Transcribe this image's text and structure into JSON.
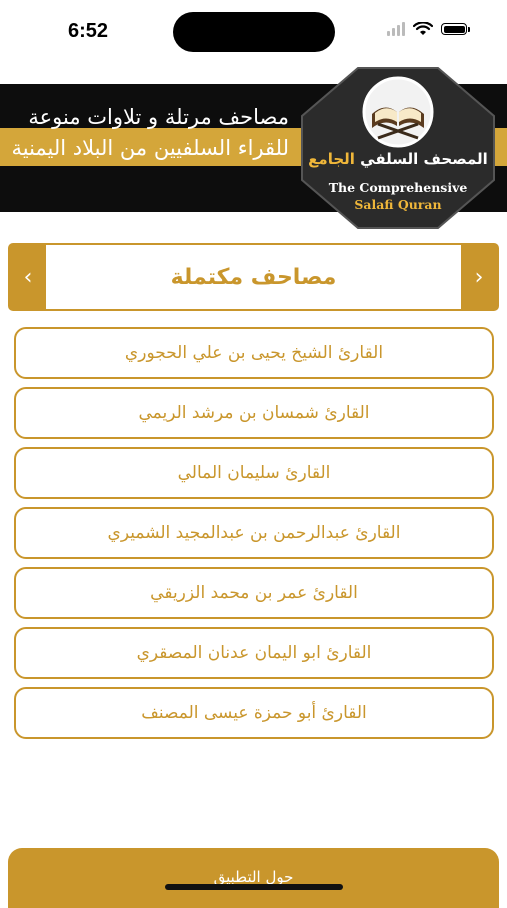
{
  "status": {
    "time": "6:52"
  },
  "banner": {
    "subtitle": "مصاحف مرتلة و تلاوات منوعة للقراء السلفيين من البلاد اليمنية",
    "logo_title_main": "المصحف السلفي",
    "logo_title_accent": "الجامع",
    "logo_en_line1": "The Comprehensive",
    "logo_en_line2": "Salafi Quran"
  },
  "section": {
    "title": "مصاحف مكتملة"
  },
  "reciters": [
    "القارئ الشيخ يحيى بن علي الحجوري",
    "القارئ شمسان بن مرشد الريمي",
    "القارئ سليمان المالي",
    "القارئ عبدالرحمن بن عبدالمجيد الشميري",
    "القارئ عمر بن محمد الزريقي",
    "القارئ ابو اليمان عدنان المصقري",
    "القارئ أبو حمزة عيسى المصنف"
  ],
  "bottom": {
    "about_label": "حول التطبيق"
  },
  "colors": {
    "gold": "#c9962c",
    "banner_gold": "#d4a63a",
    "black": "#0d0d0d"
  }
}
